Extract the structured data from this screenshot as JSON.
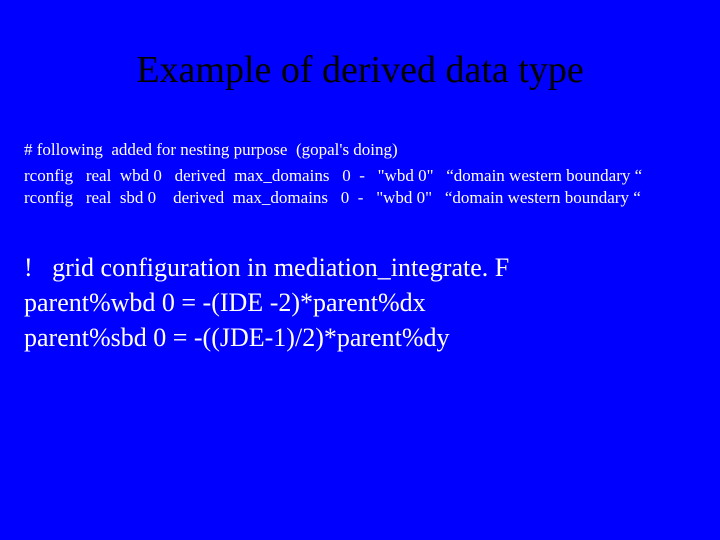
{
  "title": "Example of derived data type",
  "comment": "# following  added for nesting purpose  (gopal's doing)",
  "rconfig1": "rconfig   real  wbd 0   derived  max_domains   0  -   \"wbd 0\"   “domain western boundary “",
  "rconfig2": "rconfig   real  sbd 0    derived  max_domains   0  -   \"wbd 0\"   “domain western boundary “",
  "code1": "!   grid configuration in mediation_integrate. F",
  "code2": "parent%wbd 0 = -(IDE -2)*parent%dx",
  "code3": "parent%sbd 0 = -((JDE-1)/2)*parent%dy"
}
